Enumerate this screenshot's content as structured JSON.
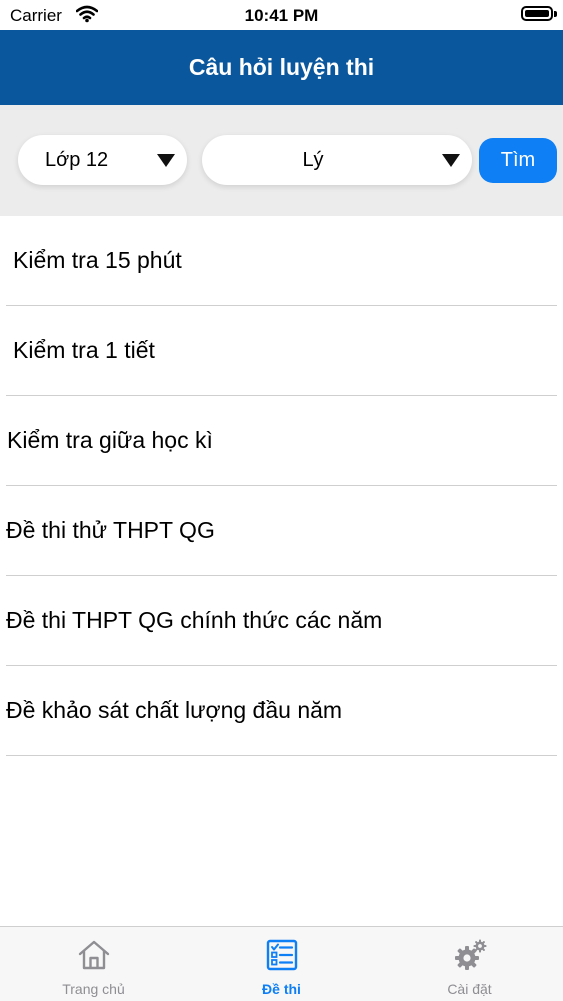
{
  "status_bar": {
    "carrier": "Carrier",
    "time": "10:41 PM"
  },
  "header": {
    "title": "Câu hỏi luyện thi"
  },
  "filters": {
    "grade": {
      "selected": "Lớp 12"
    },
    "subject": {
      "selected": "Lý"
    },
    "search_label": "Tìm"
  },
  "exam_list": [
    {
      "label": "Kiểm tra 15 phút"
    },
    {
      "label": "Kiểm tra 1 tiết"
    },
    {
      "label": "Kiểm tra giữa học kì"
    },
    {
      "label": "Đề thi thử THPT QG"
    },
    {
      "label": "Đề thi THPT QG chính thức các năm"
    },
    {
      "label": "Đề khảo sát chất lượng đầu năm"
    }
  ],
  "tab_bar": {
    "tabs": [
      {
        "label": "Trang chủ",
        "icon": "home-icon"
      },
      {
        "label": "Đề thi",
        "icon": "checklist-icon",
        "active": true
      },
      {
        "label": "Cài đặt",
        "icon": "gears-icon"
      }
    ]
  },
  "colors": {
    "nav_bar": "#0a579e",
    "accent": "#0f7ff5",
    "filter_bg": "#ececec",
    "tab_inactive": "#8e8e93"
  }
}
